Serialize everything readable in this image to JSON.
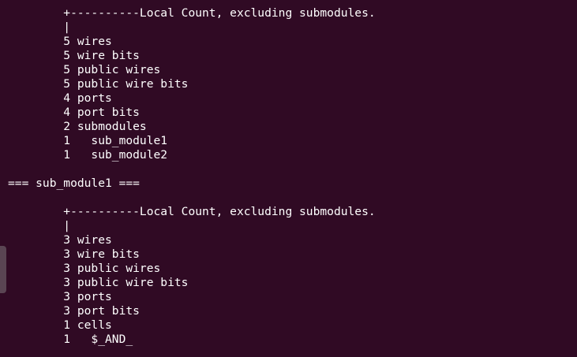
{
  "terminal": {
    "lines": [
      "        +----------Local Count, excluding submodules.",
      "        |",
      "        5 wires",
      "        5 wire bits",
      "        5 public wires",
      "        5 public wire bits",
      "        4 ports",
      "        4 port bits",
      "        2 submodules",
      "        1   sub_module1",
      "        1   sub_module2",
      "",
      "=== sub_module1 ===",
      "",
      "        +----------Local Count, excluding submodules.",
      "        |",
      "        3 wires",
      "        3 wire bits",
      "        3 public wires",
      "        3 public wire bits",
      "        3 ports",
      "        3 port bits",
      "        1 cells",
      "        1   $_AND_"
    ]
  }
}
